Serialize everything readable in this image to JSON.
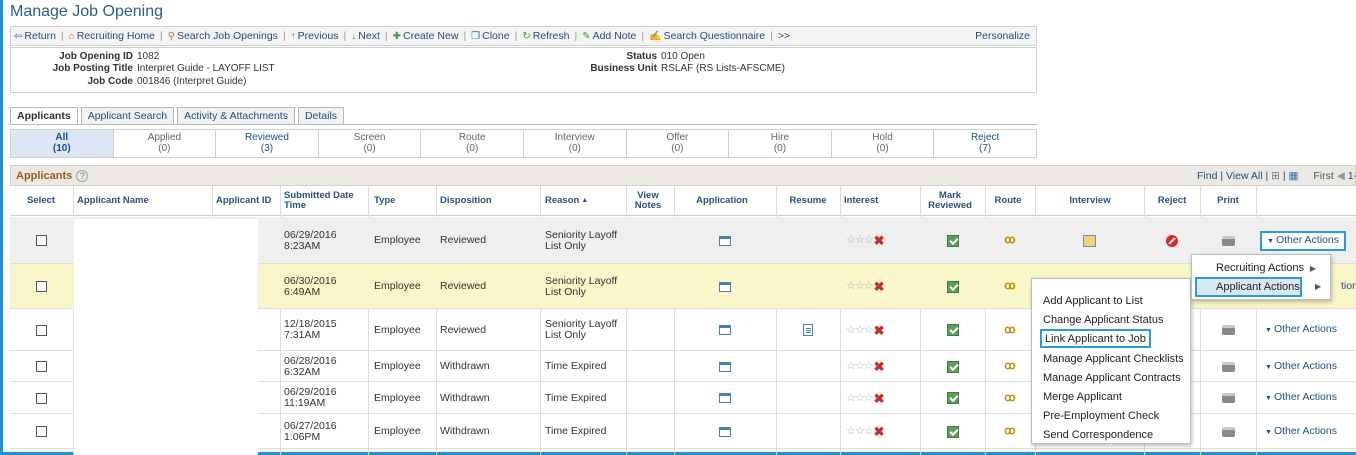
{
  "page": {
    "title": "Manage Job Opening"
  },
  "toolbar": {
    "items": [
      "Return",
      "Recruiting Home",
      "Search Job Openings",
      "Previous",
      "Next",
      "Create New",
      "Clone",
      "Refresh",
      "Add Note",
      "Search Questionnaire",
      ">>"
    ],
    "personalize": "Personalize"
  },
  "job": {
    "id_label": "Job Opening ID",
    "id": "1082",
    "posting_label": "Job Posting Title",
    "posting": "Interpret Guide - LAYOFF LIST",
    "code_label": "Job Code",
    "code": "001846 (Interpret Guide)",
    "status_label": "Status",
    "status": "010 Open",
    "bu_label": "Business Unit",
    "bu": "RSLAF (RS Lists-AFSCME)"
  },
  "tabs": [
    "Applicants",
    "Applicant Search",
    "Activity & Attachments",
    "Details"
  ],
  "status_tabs": [
    {
      "label": "All",
      "count": "(10)"
    },
    {
      "label": "Applied",
      "count": "(0)"
    },
    {
      "label": "Reviewed",
      "count": "(3)"
    },
    {
      "label": "Screen",
      "count": "(0)"
    },
    {
      "label": "Route",
      "count": "(0)"
    },
    {
      "label": "Interview",
      "count": "(0)"
    },
    {
      "label": "Offer",
      "count": "(0)"
    },
    {
      "label": "Hire",
      "count": "(0)"
    },
    {
      "label": "Hold",
      "count": "(0)"
    },
    {
      "label": "Reject",
      "count": "(7)"
    }
  ],
  "grid": {
    "title": "Applicants",
    "help": "?",
    "nav": "Find | View All |",
    "first": "First",
    "nav_tail": "1-",
    "columns": {
      "select": "Select",
      "name": "Applicant Name",
      "id": "Applicant ID",
      "submitted": "Submitted Date Time",
      "type": "Type",
      "disposition": "Disposition",
      "reason": "Reason",
      "view_notes": "View Notes",
      "application": "Application",
      "resume": "Resume",
      "interest": "Interest",
      "mark_reviewed": "Mark Reviewed",
      "route": "Route",
      "interview": "Interview",
      "reject": "Reject",
      "print": "Print"
    },
    "sort_indicator": "▲",
    "rows": [
      {
        "date": "06/29/2016",
        "time": "8:23AM",
        "type": "Employee",
        "disposition": "Reviewed",
        "reason": "Seniority Layoff List Only",
        "actions": "Other Actions"
      },
      {
        "date": "06/30/2016",
        "time": "6:49AM",
        "type": "Employee",
        "disposition": "Reviewed",
        "reason": "Seniority Layoff List Only",
        "actions": "tions"
      },
      {
        "date": "12/18/2015",
        "time": "7:31AM",
        "type": "Employee",
        "disposition": "Reviewed",
        "reason": "Seniority Layoff List Only",
        "actions": "Other Actions"
      },
      {
        "date": "06/28/2016",
        "time": "6:32AM",
        "type": "Employee",
        "disposition": "Withdrawn",
        "reason": "Time Expired",
        "actions": "Other Actions"
      },
      {
        "date": "06/29/2016",
        "time": "11:19AM",
        "type": "Employee",
        "disposition": "Withdrawn",
        "reason": "Time Expired",
        "actions": "Other Actions"
      },
      {
        "date": "06/27/2016",
        "time": "1:06PM",
        "type": "Employee",
        "disposition": "Withdrawn",
        "reason": "Time Expired",
        "actions": "Other Actions"
      }
    ]
  },
  "menu": {
    "level1": [
      "Recruiting Actions",
      "Applicant Actions"
    ],
    "level2": [
      "Add Applicant to List",
      "Change Applicant Status",
      "Link Applicant to Job",
      "Manage Applicant Checklists",
      "Manage Applicant Contracts",
      "Merge Applicant",
      "Pre-Employment Check",
      "Send Correspondence"
    ]
  }
}
